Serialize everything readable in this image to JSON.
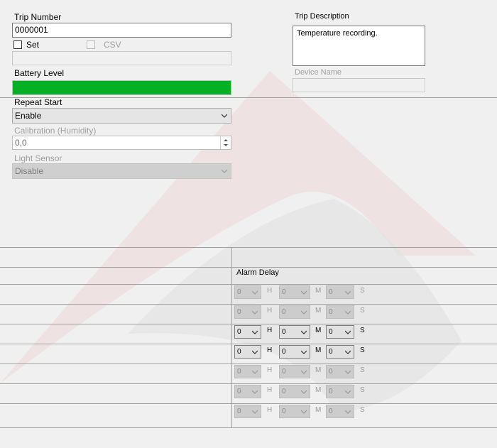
{
  "trip_number": {
    "label": "Trip Number",
    "value": "0000001"
  },
  "set_checkbox": {
    "label": "Set",
    "checked": false
  },
  "csv_checkbox": {
    "label": "CSV",
    "checked": false
  },
  "battery": {
    "label": "Battery Level",
    "level_fraction": 1.0,
    "color": "#06b025"
  },
  "repeat_start": {
    "label": "Repeat Start",
    "value": "Enable"
  },
  "calibration": {
    "label": "Calibration (Humidity)",
    "value": "0,0"
  },
  "light_sensor": {
    "label": "Light Sensor",
    "value": "Disable"
  },
  "trip_description": {
    "label": "Trip Description",
    "value": "Temperature recording."
  },
  "device_name": {
    "label": "Device Name",
    "value": ""
  },
  "alarm": {
    "header": "Alarm Delay",
    "units": {
      "h": "H",
      "m": "M",
      "s": "S"
    },
    "rows": [
      {
        "h": "0",
        "m": "0",
        "s": "0",
        "enabled": false
      },
      {
        "h": "0",
        "m": "0",
        "s": "0",
        "enabled": false
      },
      {
        "h": "0",
        "m": "0",
        "s": "0",
        "enabled": true
      },
      {
        "h": "0",
        "m": "0",
        "s": "0",
        "enabled": true
      },
      {
        "h": "0",
        "m": "0",
        "s": "0",
        "enabled": false
      },
      {
        "h": "0",
        "m": "0",
        "s": "0",
        "enabled": false
      },
      {
        "h": "0",
        "m": "0",
        "s": "0",
        "enabled": false
      }
    ]
  }
}
